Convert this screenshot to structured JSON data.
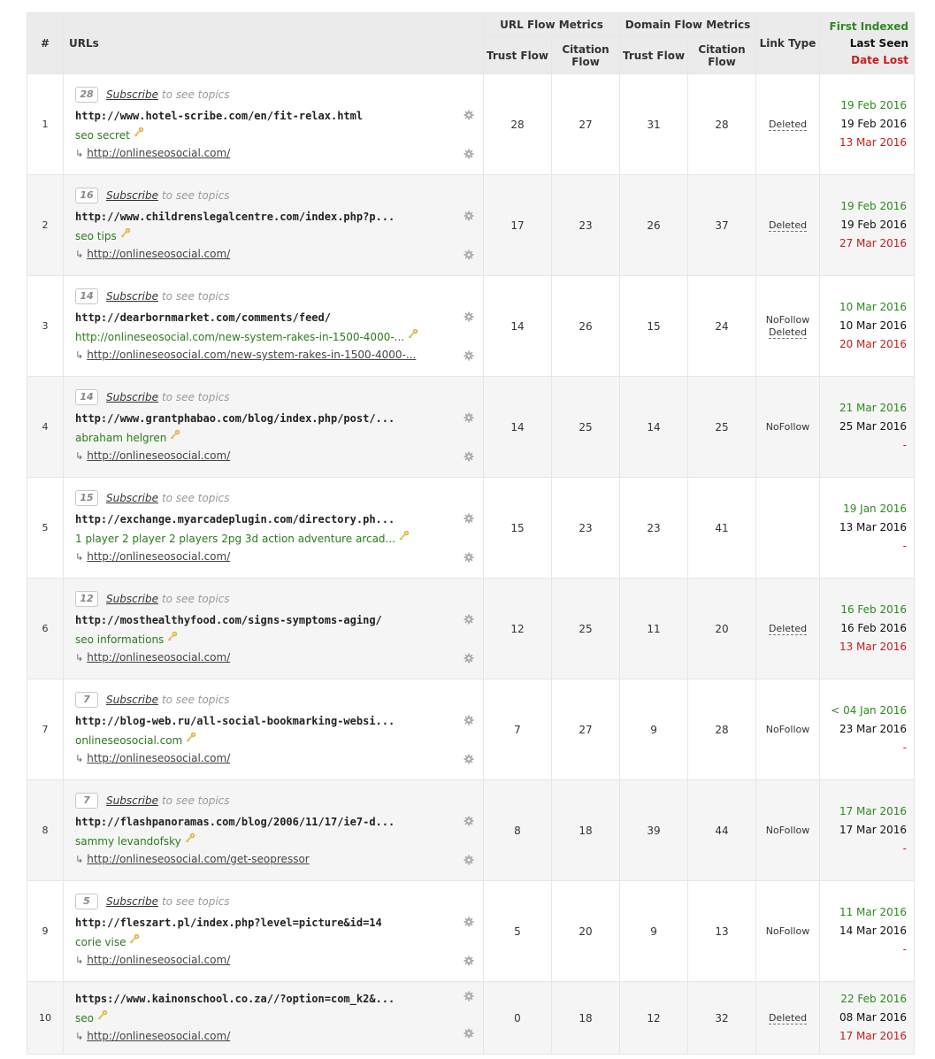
{
  "header": {
    "num": "#",
    "urls": "URLs",
    "url_flow": "URL Flow Metrics",
    "domain_flow": "Domain Flow Metrics",
    "trust_flow": "Trust Flow",
    "citation_flow": "Citation Flow",
    "link_type": "Link Type",
    "first_indexed": "First Indexed",
    "last_seen": "Last Seen",
    "date_lost": "Date Lost"
  },
  "labels": {
    "subscribe": "Subscribe",
    "see_topics": "to see topics",
    "arrow": "↳"
  },
  "colors": {
    "first_indexed": "#2d8a1f",
    "last_seen": "#111111",
    "date_lost": "#c51e1e",
    "anchor_text": "#2d7a1f"
  },
  "rows": [
    {
      "num": "1",
      "badge": "28",
      "url": "http://www.hotel-scribe.com/en/fit-relax.html",
      "anchor": "seo secret",
      "target": "http://onlineseosocial.com/",
      "url_tf": "28",
      "url_cf": "27",
      "dom_tf": "31",
      "dom_cf": "28",
      "link_type": [
        "Deleted"
      ],
      "first_indexed": "19 Feb 2016",
      "last_seen": "19 Feb 2016",
      "date_lost": "13 Mar 2016"
    },
    {
      "num": "2",
      "badge": "16",
      "url": "http://www.childrenslegalcentre.com/index.php?p...",
      "anchor": "seo tips",
      "target": "http://onlineseosocial.com/",
      "url_tf": "17",
      "url_cf": "23",
      "dom_tf": "26",
      "dom_cf": "37",
      "link_type": [
        "Deleted"
      ],
      "first_indexed": "19 Feb 2016",
      "last_seen": "19 Feb 2016",
      "date_lost": "27 Mar 2016"
    },
    {
      "num": "3",
      "badge": "14",
      "url": "http://dearbornmarket.com/comments/feed/",
      "anchor": "http://onlineseosocial.com/new-system-rakes-in-1500-4000-...",
      "target": "http://onlineseosocial.com/new-system-rakes-in-1500-4000-...",
      "url_tf": "14",
      "url_cf": "26",
      "dom_tf": "15",
      "dom_cf": "24",
      "link_type": [
        "NoFollow",
        "Deleted"
      ],
      "first_indexed": "10 Mar 2016",
      "last_seen": "10 Mar 2016",
      "date_lost": "20 Mar 2016"
    },
    {
      "num": "4",
      "badge": "14",
      "url": "http://www.grantphabao.com/blog/index.php/post/...",
      "anchor": "abraham helgren",
      "target": "http://onlineseosocial.com/",
      "url_tf": "14",
      "url_cf": "25",
      "dom_tf": "14",
      "dom_cf": "25",
      "link_type": [
        "NoFollow"
      ],
      "first_indexed": "21 Mar 2016",
      "last_seen": "25 Mar 2016",
      "date_lost": "-"
    },
    {
      "num": "5",
      "badge": "15",
      "url": "http://exchange.myarcadeplugin.com/directory.ph...",
      "anchor": "1 player 2 player 2 players 2pg 3d action adventure arcad...",
      "target": "http://onlineseosocial.com/",
      "url_tf": "15",
      "url_cf": "23",
      "dom_tf": "23",
      "dom_cf": "41",
      "link_type": [],
      "first_indexed": "19 Jan 2016",
      "last_seen": "13 Mar 2016",
      "date_lost": "-"
    },
    {
      "num": "6",
      "badge": "12",
      "url": "http://mosthealthyfood.com/signs-symptoms-aging/",
      "anchor": "seo informations",
      "target": "http://onlineseosocial.com/",
      "url_tf": "12",
      "url_cf": "25",
      "dom_tf": "11",
      "dom_cf": "20",
      "link_type": [
        "Deleted"
      ],
      "first_indexed": "16 Feb 2016",
      "last_seen": "16 Feb 2016",
      "date_lost": "13 Mar 2016"
    },
    {
      "num": "7",
      "badge": "7",
      "url": "http://blog-web.ru/all-social-bookmarking-websi...",
      "anchor": "onlineseosocial.com",
      "target": "http://onlineseosocial.com/",
      "url_tf": "7",
      "url_cf": "27",
      "dom_tf": "9",
      "dom_cf": "28",
      "link_type": [
        "NoFollow"
      ],
      "first_indexed": "< 04 Jan 2016",
      "last_seen": "23 Mar 2016",
      "date_lost": "-"
    },
    {
      "num": "8",
      "badge": "7",
      "url": "http://flashpanoramas.com/blog/2006/11/17/ie7-d...",
      "anchor": "sammy levandofsky",
      "target": "http://onlineseosocial.com/get-seopressor",
      "url_tf": "8",
      "url_cf": "18",
      "dom_tf": "39",
      "dom_cf": "44",
      "link_type": [
        "NoFollow"
      ],
      "first_indexed": "17 Mar 2016",
      "last_seen": "17 Mar 2016",
      "date_lost": "-"
    },
    {
      "num": "9",
      "badge": "5",
      "url": "http://fleszart.pl/index.php?level=picture&id=14",
      "anchor": "corie vise",
      "target": "http://onlineseosocial.com/",
      "url_tf": "5",
      "url_cf": "20",
      "dom_tf": "9",
      "dom_cf": "13",
      "link_type": [
        "NoFollow"
      ],
      "first_indexed": "11 Mar 2016",
      "last_seen": "14 Mar 2016",
      "date_lost": "-"
    },
    {
      "num": "10",
      "badge": "",
      "url": "https://www.kainonschool.co.za//?option=com_k2&...",
      "anchor": "seo",
      "target": "http://onlineseosocial.com/",
      "url_tf": "0",
      "url_cf": "18",
      "dom_tf": "12",
      "dom_cf": "32",
      "link_type": [
        "Deleted"
      ],
      "first_indexed": "22 Feb 2016",
      "last_seen": "08 Mar 2016",
      "date_lost": "17 Mar 2016"
    }
  ]
}
